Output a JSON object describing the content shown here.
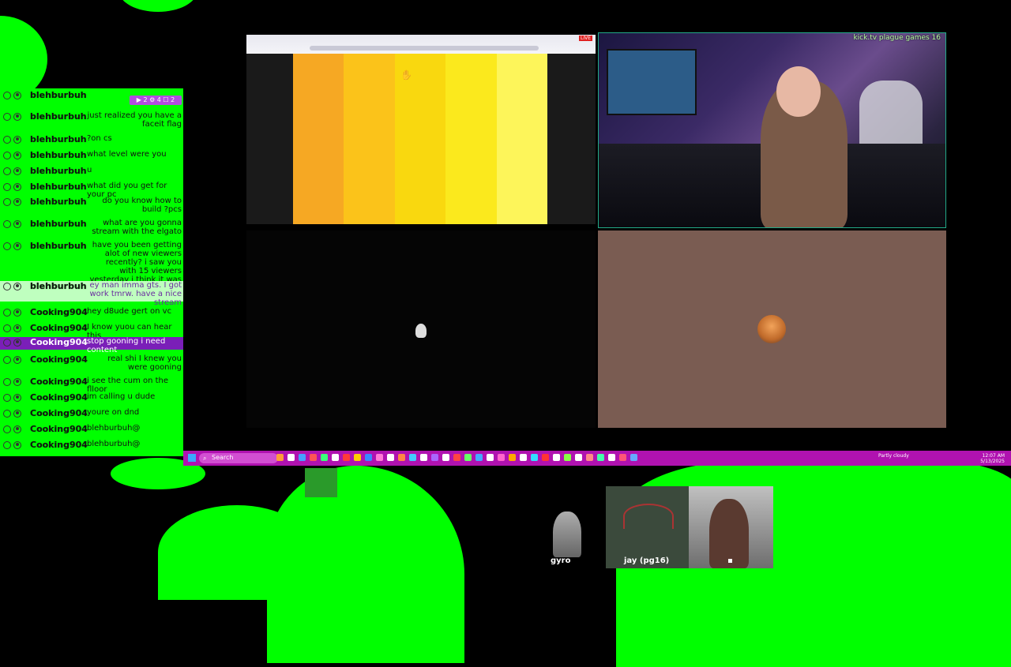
{
  "chat": {
    "badge_text": "▶ 2 ⚙ 4 ☐ 2",
    "messages": [
      {
        "user": "blehburbuh",
        "text": ""
      },
      {
        "user": "blehburbuh",
        "text": "just realized you have a faceit flag"
      },
      {
        "user": "blehburbuh",
        "text": "?on cs"
      },
      {
        "user": "blehburbuh",
        "text": "what level were you"
      },
      {
        "user": "blehburbuh",
        "text": "u"
      },
      {
        "user": "blehburbuh",
        "text": "what did you get for your pc"
      },
      {
        "user": "blehburbuh",
        "text": "do you know how to build ?pcs"
      },
      {
        "user": "blehburbuh",
        "text": "what are you gonna stream with the elgato"
      },
      {
        "user": "blehburbuh",
        "text": "have you been getting alot of new viewers recently? i saw you with 15 viewers yesterday i think it was"
      },
      {
        "user": "blehburbuh",
        "text": "ey man imma gts. I got work tmrw. have a nice stream"
      },
      {
        "user": "Cooking904",
        "text": "hey d8ude gert on vc"
      },
      {
        "user": "Cooking904",
        "text": "I know yuou can hear this"
      },
      {
        "user": "Cooking904",
        "text": "stop gooning i need content"
      },
      {
        "user": "Cooking904",
        "text": "real shi I knew you were gooning"
      },
      {
        "user": "Cooking904",
        "text": "i see the cum on the flloor"
      },
      {
        "user": "Cooking904",
        "text": "im calling u dude"
      },
      {
        "user": "Cooking904",
        "text": "youre on dnd"
      },
      {
        "user": "Cooking904",
        "text": "blehburbuh@"
      },
      {
        "user": "Cooking904",
        "text": "blehburbuh@"
      }
    ]
  },
  "browser": {
    "live_label": "LIVE",
    "stripe_colors": [
      "#f6a823",
      "#fbc31a",
      "#f9d80f",
      "#fbe91d",
      "#fdf55a"
    ]
  },
  "webcam": {
    "overlay_title": "kick.tv plague games 16"
  },
  "taskbar": {
    "search_label": "Search",
    "weather": "Partly cloudy",
    "clock_time": "12:07 AM",
    "clock_date": "5/13/2025",
    "icon_colors": [
      "#ff9d3a",
      "#ffffff",
      "#46a0ff",
      "#ff5555",
      "#3aff7a",
      "#ffffff",
      "#ff3a3a",
      "#ffcc00",
      "#3a88ff",
      "#ff7ad6",
      "#ffffff",
      "#ff8844",
      "#44ccff",
      "#ffffff",
      "#aa66ff",
      "#ffffff",
      "#ff4444",
      "#66ff66",
      "#44aaff",
      "#ffffff",
      "#ff66cc",
      "#ffaa00",
      "#ffffff",
      "#33ddff",
      "#ff3333",
      "#ffffff",
      "#88ff44",
      "#ffffff",
      "#ff8888",
      "#44ffaa",
      "#ffffff",
      "#ff5577",
      "#66aaff"
    ]
  },
  "participants": {
    "gyro": "gyro",
    "jay": "jay (pg16)"
  }
}
